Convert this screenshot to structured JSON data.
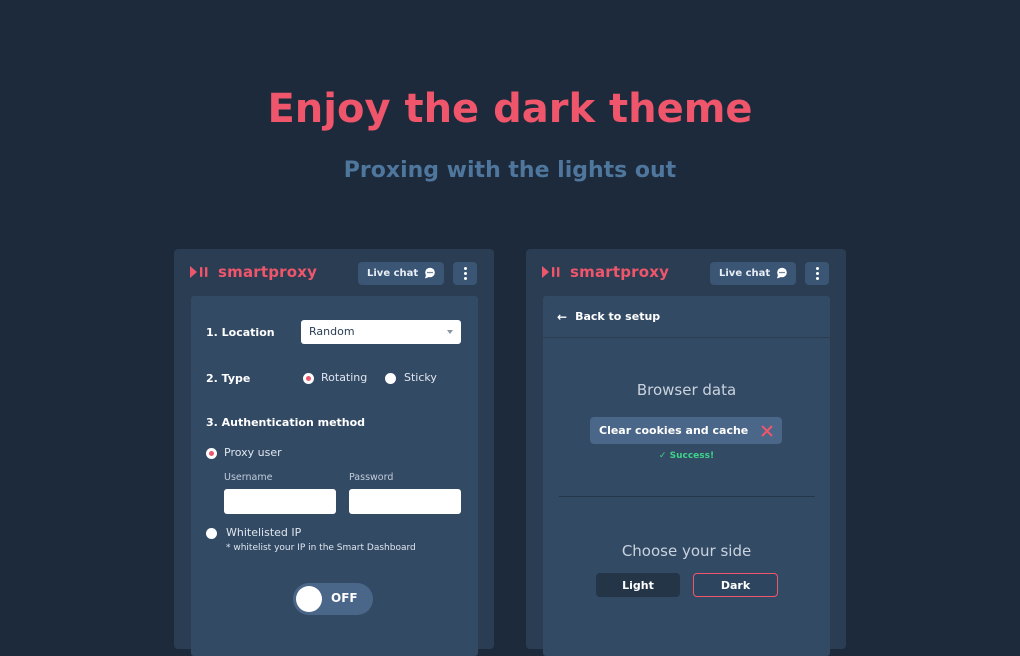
{
  "hero": {
    "title": "Enjoy the dark theme",
    "subtitle": "Proxing with the lights out"
  },
  "colors": {
    "accent": "#f0566b",
    "background": "#1c2a3b",
    "panel": "#2a3d53",
    "success": "#3fd28a"
  },
  "brand": {
    "name": "smartproxy"
  },
  "header": {
    "live_chat_label": "Live chat",
    "chat_icon": "chat-bubble-icon",
    "menu_icon": "kebab-menu-icon"
  },
  "setup": {
    "location_label": "1. Location",
    "location_value": "Random",
    "type_label": "2. Type",
    "type_options": [
      {
        "label": "Rotating",
        "selected": true
      },
      {
        "label": "Sticky",
        "selected": false
      }
    ],
    "auth_label": "3. Authentication method",
    "auth_options": [
      {
        "label": "Proxy user",
        "selected": true
      },
      {
        "label": "Whitelisted IP",
        "selected": false
      }
    ],
    "username_label": "Username",
    "password_label": "Password",
    "username_value": "",
    "password_value": "",
    "whitelist_note": "* whitelist your IP in the Smart Dashboard",
    "toggle_label": "OFF"
  },
  "settings": {
    "back_label": "Back to setup",
    "browser_data_title": "Browser data",
    "clear_label": "Clear cookies and cache",
    "success_text": "Success!",
    "side_title": "Choose your side",
    "light_label": "Light",
    "dark_label": "Dark",
    "selected_theme": "Dark"
  }
}
